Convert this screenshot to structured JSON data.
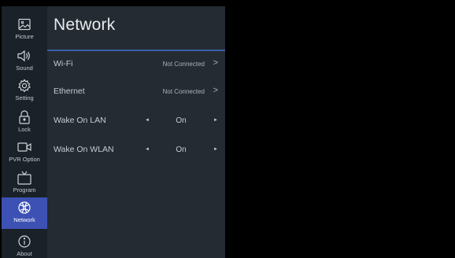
{
  "sidebar": {
    "items": [
      {
        "label": "Picture",
        "icon": "picture-icon"
      },
      {
        "label": "Sound",
        "icon": "speaker-icon"
      },
      {
        "label": "Setting",
        "icon": "gear-icon"
      },
      {
        "label": "Lock",
        "icon": "lock-icon"
      },
      {
        "label": "PVR Option",
        "icon": "camera-icon"
      },
      {
        "label": "Program",
        "icon": "tv-icon"
      },
      {
        "label": "Network",
        "icon": "globe-icon",
        "active": true
      },
      {
        "label": "About",
        "icon": "info-icon"
      }
    ]
  },
  "panel": {
    "title": "Network",
    "rows": [
      {
        "label": "Wi-Fi",
        "status": "Not Connected",
        "chevron": ">"
      },
      {
        "label": "Ethernet",
        "status": "Not Connected",
        "chevron": ">"
      },
      {
        "label": "Wake On LAN",
        "value": "On",
        "left_arrow": "◄",
        "right_arrow": "►"
      },
      {
        "label": "Wake On WLAN",
        "value": "On",
        "left_arrow": "◄",
        "right_arrow": "►"
      }
    ]
  },
  "colors": {
    "sidebar_bg": "#1a2128",
    "panel_bg": "#242b32",
    "active_bg": "#3c51b3",
    "accent_rule": "#3a5ea8",
    "background": "#000000"
  }
}
